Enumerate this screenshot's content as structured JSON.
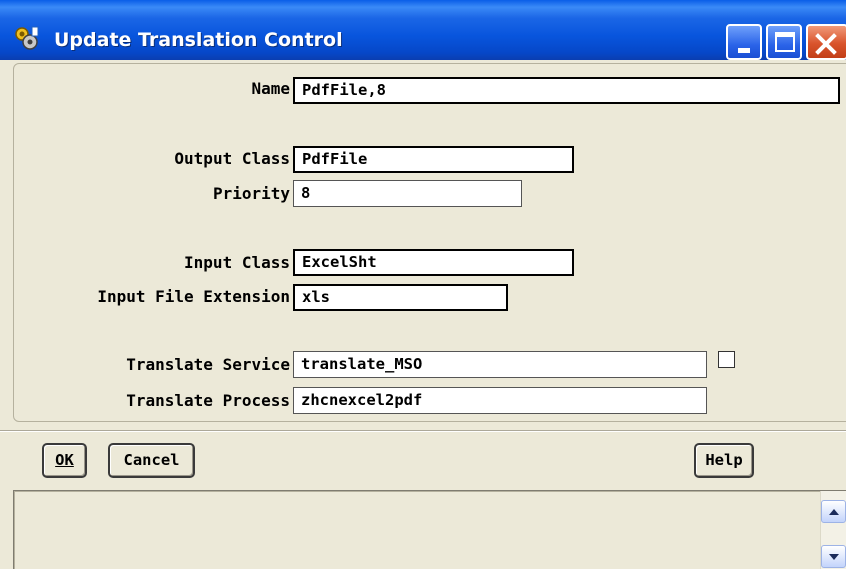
{
  "window": {
    "title": "Update Translation Control",
    "icon": "gear-app-icon",
    "controls": [
      "minimize-icon",
      "maximize-icon",
      "close-icon"
    ]
  },
  "form": {
    "name": {
      "label": "Name",
      "value": "PdfFile,8"
    },
    "output_class": {
      "label": "Output Class",
      "value": "PdfFile"
    },
    "priority": {
      "label": "Priority",
      "value": "8"
    },
    "input_class": {
      "label": "Input Class",
      "value": "ExcelSht"
    },
    "input_file_extension": {
      "label": "Input File Extension",
      "value": "xls"
    },
    "translate_service": {
      "label": "Translate Service",
      "value": "translate_MSO",
      "checkbox_checked": false
    },
    "translate_process": {
      "label": "Translate Process",
      "value": "zhcnexcel2pdf"
    }
  },
  "buttons": {
    "ok": "OK",
    "cancel": "Cancel",
    "help": "Help"
  },
  "colors": {
    "titlebar": "#0855dd",
    "background": "#ece9d8",
    "close_button": "#d9542c"
  }
}
